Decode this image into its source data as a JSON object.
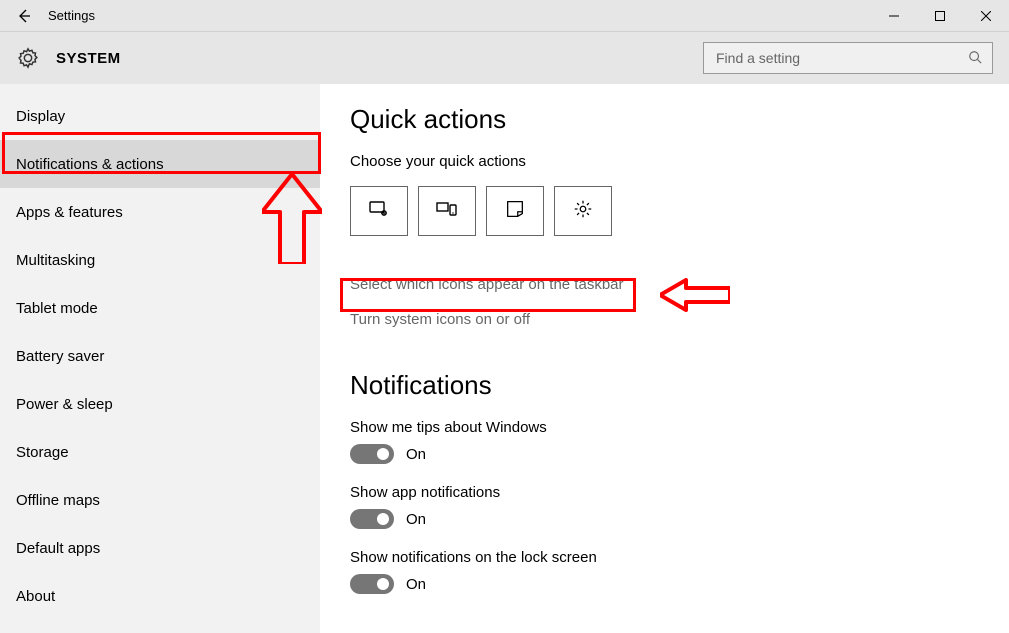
{
  "window": {
    "title": "Settings",
    "system_label": "SYSTEM",
    "search_placeholder": "Find a setting"
  },
  "sidebar": {
    "items": [
      {
        "label": "Display",
        "selected": false
      },
      {
        "label": "Notifications & actions",
        "selected": true
      },
      {
        "label": "Apps & features",
        "selected": false
      },
      {
        "label": "Multitasking",
        "selected": false
      },
      {
        "label": "Tablet mode",
        "selected": false
      },
      {
        "label": "Battery saver",
        "selected": false
      },
      {
        "label": "Power & sleep",
        "selected": false
      },
      {
        "label": "Storage",
        "selected": false
      },
      {
        "label": "Offline maps",
        "selected": false
      },
      {
        "label": "Default apps",
        "selected": false
      },
      {
        "label": "About",
        "selected": false
      }
    ]
  },
  "main": {
    "quick_actions_heading": "Quick actions",
    "choose_label": "Choose your quick actions",
    "qa_icons": [
      "tablet-mode-icon",
      "connect-icon",
      "note-icon",
      "settings-icon"
    ],
    "link_taskbar_icons": "Select which icons appear on the taskbar",
    "link_system_icons": "Turn system icons on or off",
    "notifications_heading": "Notifications",
    "toggles": [
      {
        "label": "Show me tips about Windows",
        "state": "On"
      },
      {
        "label": "Show app notifications",
        "state": "On"
      },
      {
        "label": "Show notifications on the lock screen",
        "state": "On"
      }
    ]
  },
  "annotations": {
    "highlight_color": "#ff0000"
  }
}
